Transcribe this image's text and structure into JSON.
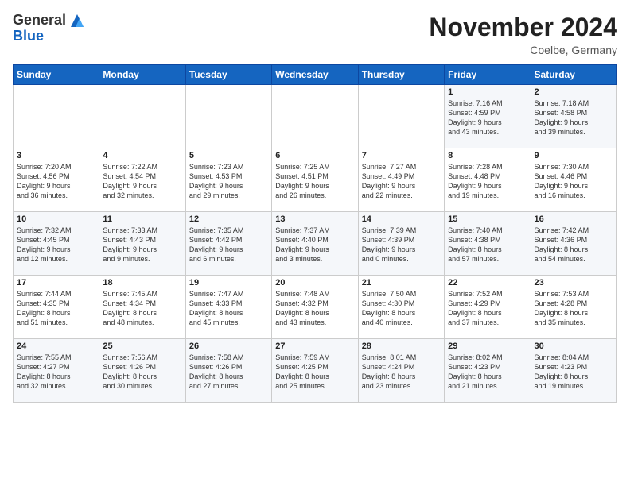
{
  "header": {
    "logo_general": "General",
    "logo_blue": "Blue",
    "month_title": "November 2024",
    "location": "Coelbe, Germany"
  },
  "weekdays": [
    "Sunday",
    "Monday",
    "Tuesday",
    "Wednesday",
    "Thursday",
    "Friday",
    "Saturday"
  ],
  "weeks": [
    [
      {
        "day": "",
        "info": ""
      },
      {
        "day": "",
        "info": ""
      },
      {
        "day": "",
        "info": ""
      },
      {
        "day": "",
        "info": ""
      },
      {
        "day": "",
        "info": ""
      },
      {
        "day": "1",
        "info": "Sunrise: 7:16 AM\nSunset: 4:59 PM\nDaylight: 9 hours\nand 43 minutes."
      },
      {
        "day": "2",
        "info": "Sunrise: 7:18 AM\nSunset: 4:58 PM\nDaylight: 9 hours\nand 39 minutes."
      }
    ],
    [
      {
        "day": "3",
        "info": "Sunrise: 7:20 AM\nSunset: 4:56 PM\nDaylight: 9 hours\nand 36 minutes."
      },
      {
        "day": "4",
        "info": "Sunrise: 7:22 AM\nSunset: 4:54 PM\nDaylight: 9 hours\nand 32 minutes."
      },
      {
        "day": "5",
        "info": "Sunrise: 7:23 AM\nSunset: 4:53 PM\nDaylight: 9 hours\nand 29 minutes."
      },
      {
        "day": "6",
        "info": "Sunrise: 7:25 AM\nSunset: 4:51 PM\nDaylight: 9 hours\nand 26 minutes."
      },
      {
        "day": "7",
        "info": "Sunrise: 7:27 AM\nSunset: 4:49 PM\nDaylight: 9 hours\nand 22 minutes."
      },
      {
        "day": "8",
        "info": "Sunrise: 7:28 AM\nSunset: 4:48 PM\nDaylight: 9 hours\nand 19 minutes."
      },
      {
        "day": "9",
        "info": "Sunrise: 7:30 AM\nSunset: 4:46 PM\nDaylight: 9 hours\nand 16 minutes."
      }
    ],
    [
      {
        "day": "10",
        "info": "Sunrise: 7:32 AM\nSunset: 4:45 PM\nDaylight: 9 hours\nand 12 minutes."
      },
      {
        "day": "11",
        "info": "Sunrise: 7:33 AM\nSunset: 4:43 PM\nDaylight: 9 hours\nand 9 minutes."
      },
      {
        "day": "12",
        "info": "Sunrise: 7:35 AM\nSunset: 4:42 PM\nDaylight: 9 hours\nand 6 minutes."
      },
      {
        "day": "13",
        "info": "Sunrise: 7:37 AM\nSunset: 4:40 PM\nDaylight: 9 hours\nand 3 minutes."
      },
      {
        "day": "14",
        "info": "Sunrise: 7:39 AM\nSunset: 4:39 PM\nDaylight: 9 hours\nand 0 minutes."
      },
      {
        "day": "15",
        "info": "Sunrise: 7:40 AM\nSunset: 4:38 PM\nDaylight: 8 hours\nand 57 minutes."
      },
      {
        "day": "16",
        "info": "Sunrise: 7:42 AM\nSunset: 4:36 PM\nDaylight: 8 hours\nand 54 minutes."
      }
    ],
    [
      {
        "day": "17",
        "info": "Sunrise: 7:44 AM\nSunset: 4:35 PM\nDaylight: 8 hours\nand 51 minutes."
      },
      {
        "day": "18",
        "info": "Sunrise: 7:45 AM\nSunset: 4:34 PM\nDaylight: 8 hours\nand 48 minutes."
      },
      {
        "day": "19",
        "info": "Sunrise: 7:47 AM\nSunset: 4:33 PM\nDaylight: 8 hours\nand 45 minutes."
      },
      {
        "day": "20",
        "info": "Sunrise: 7:48 AM\nSunset: 4:32 PM\nDaylight: 8 hours\nand 43 minutes."
      },
      {
        "day": "21",
        "info": "Sunrise: 7:50 AM\nSunset: 4:30 PM\nDaylight: 8 hours\nand 40 minutes."
      },
      {
        "day": "22",
        "info": "Sunrise: 7:52 AM\nSunset: 4:29 PM\nDaylight: 8 hours\nand 37 minutes."
      },
      {
        "day": "23",
        "info": "Sunrise: 7:53 AM\nSunset: 4:28 PM\nDaylight: 8 hours\nand 35 minutes."
      }
    ],
    [
      {
        "day": "24",
        "info": "Sunrise: 7:55 AM\nSunset: 4:27 PM\nDaylight: 8 hours\nand 32 minutes."
      },
      {
        "day": "25",
        "info": "Sunrise: 7:56 AM\nSunset: 4:26 PM\nDaylight: 8 hours\nand 30 minutes."
      },
      {
        "day": "26",
        "info": "Sunrise: 7:58 AM\nSunset: 4:26 PM\nDaylight: 8 hours\nand 27 minutes."
      },
      {
        "day": "27",
        "info": "Sunrise: 7:59 AM\nSunset: 4:25 PM\nDaylight: 8 hours\nand 25 minutes."
      },
      {
        "day": "28",
        "info": "Sunrise: 8:01 AM\nSunset: 4:24 PM\nDaylight: 8 hours\nand 23 minutes."
      },
      {
        "day": "29",
        "info": "Sunrise: 8:02 AM\nSunset: 4:23 PM\nDaylight: 8 hours\nand 21 minutes."
      },
      {
        "day": "30",
        "info": "Sunrise: 8:04 AM\nSunset: 4:23 PM\nDaylight: 8 hours\nand 19 minutes."
      }
    ]
  ]
}
